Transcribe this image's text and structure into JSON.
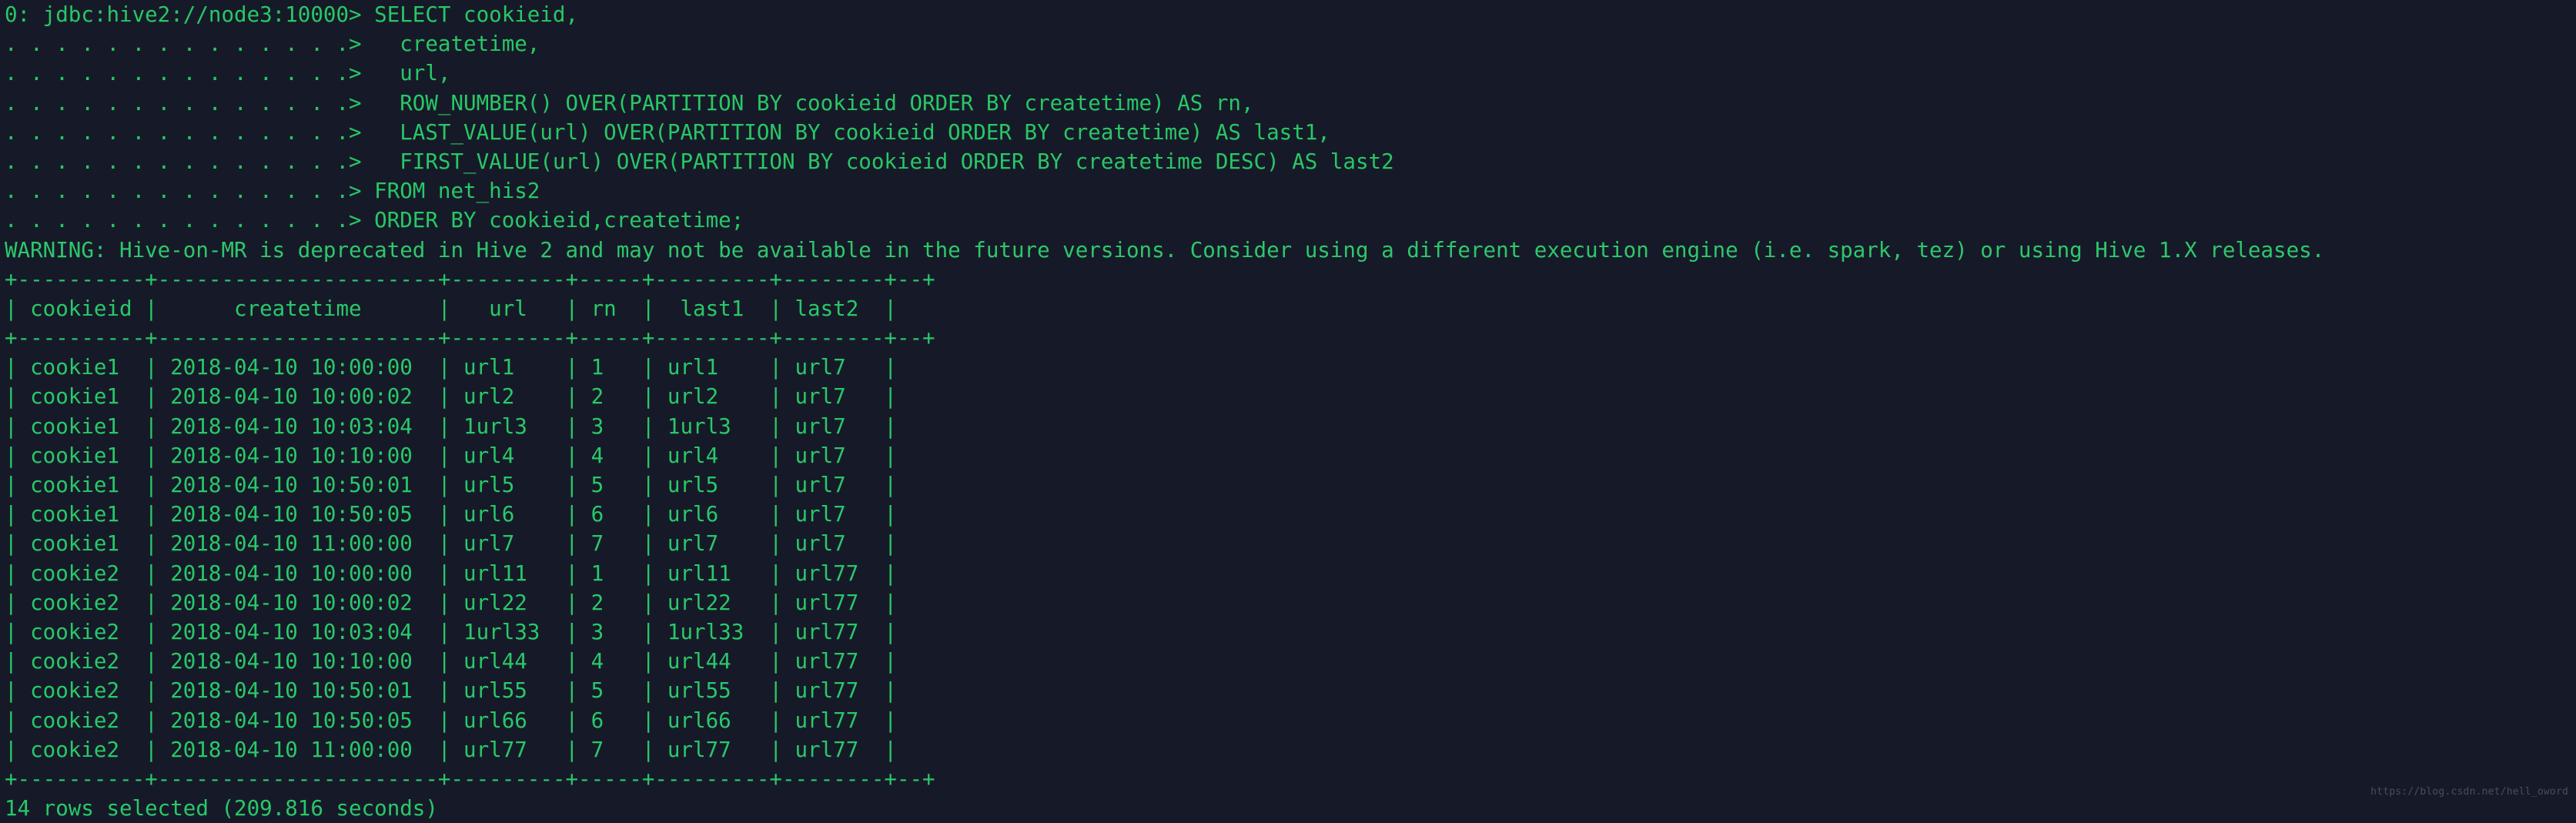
{
  "terminal": {
    "prompt": "0: jdbc:hive2://node3:10000>",
    "continuation_prompt": ". . . . . . . . . . . . . .>",
    "background_color": "#161a28",
    "text_color": "#28c766",
    "query_lines": [
      "0: jdbc:hive2://node3:10000> SELECT cookieid,",
      ". . . . . . . . . . . . . .>   createtime,",
      ". . . . . . . . . . . . . .>   url,",
      ". . . . . . . . . . . . . .>   ROW_NUMBER() OVER(PARTITION BY cookieid ORDER BY createtime) AS rn,",
      ". . . . . . . . . . . . . .>   LAST_VALUE(url) OVER(PARTITION BY cookieid ORDER BY createtime) AS last1,",
      ". . . . . . . . . . . . . .>   FIRST_VALUE(url) OVER(PARTITION BY cookieid ORDER BY createtime DESC) AS last2",
      ". . . . . . . . . . . . . .> FROM net_his2",
      ". . . . . . . . . . . . . .> ORDER BY cookieid,createtime;"
    ],
    "warning": "WARNING: Hive-on-MR is deprecated in Hive 2 and may not be available in the future versions. Consider using a different execution engine (i.e. spark, tez) or using Hive 1.X releases.",
    "result_separator": "+----------+----------------------+---------+-----+---------+--------+--+",
    "result_header": "| cookieid |      createtime      |   url   | rn  |  last1  | last2  |",
    "result_rows": [
      "| cookie1  | 2018-04-10 10:00:00  | url1    | 1   | url1    | url7   |",
      "| cookie1  | 2018-04-10 10:00:02  | url2    | 2   | url2    | url7   |",
      "| cookie1  | 2018-04-10 10:03:04  | 1url3   | 3   | 1url3   | url7   |",
      "| cookie1  | 2018-04-10 10:10:00  | url4    | 4   | url4    | url7   |",
      "| cookie1  | 2018-04-10 10:50:01  | url5    | 5   | url5    | url7   |",
      "| cookie1  | 2018-04-10 10:50:05  | url6    | 6   | url6    | url7   |",
      "| cookie1  | 2018-04-10 11:00:00  | url7    | 7   | url7    | url7   |",
      "| cookie2  | 2018-04-10 10:00:00  | url11   | 1   | url11   | url77  |",
      "| cookie2  | 2018-04-10 10:00:02  | url22   | 2   | url22   | url77  |",
      "| cookie2  | 2018-04-10 10:03:04  | 1url33  | 3   | 1url33  | url77  |",
      "| cookie2  | 2018-04-10 10:10:00  | url44   | 4   | url44   | url77  |",
      "| cookie2  | 2018-04-10 10:50:01  | url55   | 5   | url55   | url77  |",
      "| cookie2  | 2018-04-10 10:50:05  | url66   | 6   | url66   | url77  |",
      "| cookie2  | 2018-04-10 11:00:00  | url77   | 7   | url77   | url77  |"
    ],
    "footer": "14 rows selected (209.816 seconds)",
    "watermark": "https://blog.csdn.net/hell_oword"
  },
  "table_data": {
    "columns": [
      "cookieid",
      "createtime",
      "url",
      "rn",
      "last1",
      "last2"
    ],
    "rows": [
      [
        "cookie1",
        "2018-04-10 10:00:00",
        "url1",
        "1",
        "url1",
        "url7"
      ],
      [
        "cookie1",
        "2018-04-10 10:00:02",
        "url2",
        "2",
        "url2",
        "url7"
      ],
      [
        "cookie1",
        "2018-04-10 10:03:04",
        "1url3",
        "3",
        "1url3",
        "url7"
      ],
      [
        "cookie1",
        "2018-04-10 10:10:00",
        "url4",
        "4",
        "url4",
        "url7"
      ],
      [
        "cookie1",
        "2018-04-10 10:50:01",
        "url5",
        "5",
        "url5",
        "url7"
      ],
      [
        "cookie1",
        "2018-04-10 10:50:05",
        "url6",
        "6",
        "url6",
        "url7"
      ],
      [
        "cookie1",
        "2018-04-10 11:00:00",
        "url7",
        "7",
        "url7",
        "url7"
      ],
      [
        "cookie2",
        "2018-04-10 10:00:00",
        "url11",
        "1",
        "url11",
        "url77"
      ],
      [
        "cookie2",
        "2018-04-10 10:00:02",
        "url22",
        "2",
        "url22",
        "url77"
      ],
      [
        "cookie2",
        "2018-04-10 10:03:04",
        "1url33",
        "3",
        "1url33",
        "url77"
      ],
      [
        "cookie2",
        "2018-04-10 10:10:00",
        "url44",
        "4",
        "url44",
        "url77"
      ],
      [
        "cookie2",
        "2018-04-10 10:50:01",
        "url55",
        "5",
        "url55",
        "url77"
      ],
      [
        "cookie2",
        "2018-04-10 10:50:05",
        "url66",
        "6",
        "url66",
        "url77"
      ],
      [
        "cookie2",
        "2018-04-10 11:00:00",
        "url77",
        "7",
        "url77",
        "url77"
      ]
    ],
    "row_count": 14,
    "elapsed_seconds": 209.816
  }
}
